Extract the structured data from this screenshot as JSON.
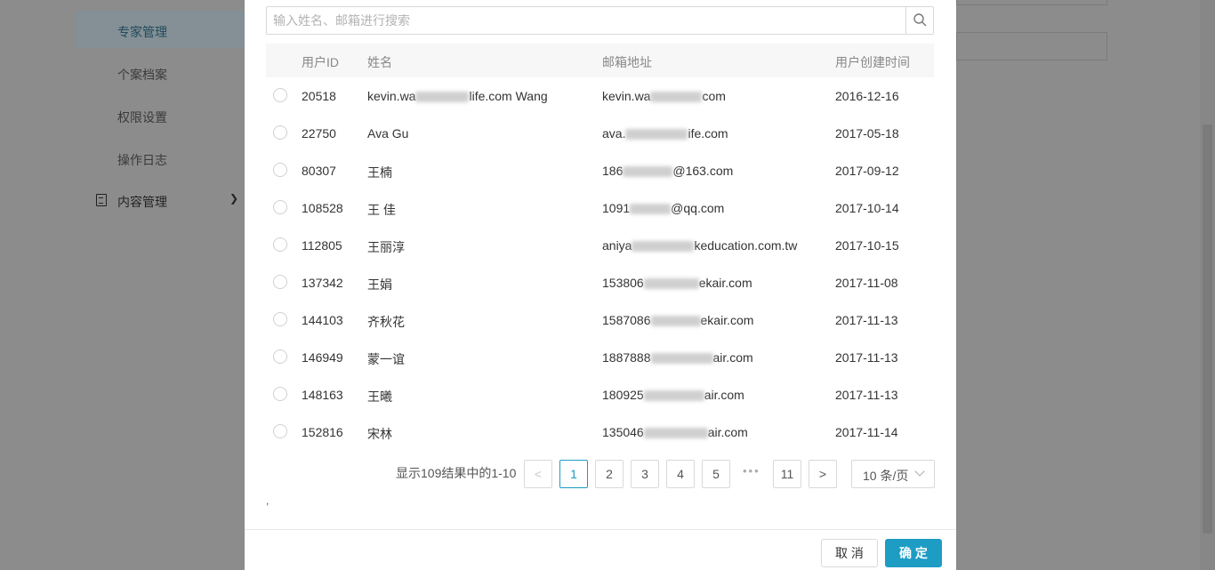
{
  "sidebar": {
    "items": [
      {
        "label": "专家管理",
        "active": true
      },
      {
        "label": "个案档案"
      },
      {
        "label": "权限设置"
      },
      {
        "label": "操作日志"
      }
    ],
    "group": {
      "label": "内容管理",
      "icon": "document-icon",
      "chevron": "chevron-down-icon"
    }
  },
  "modal": {
    "search": {
      "placeholder": "输入姓名、邮箱进行搜索",
      "value": "",
      "icon": "search-icon"
    },
    "columns": {
      "id": "用户ID",
      "name": "姓名",
      "email": "邮箱地址",
      "created": "用户创建时间"
    },
    "rows": [
      {
        "id": "20518",
        "name_pre": "kevin.wa",
        "name_post": "life.com Wang",
        "email_pre": "kevin.wa",
        "email_post": "com",
        "created": "2016-12-16"
      },
      {
        "id": "22750",
        "name_pre": "Ava Gu",
        "name_post": "",
        "email_pre": "ava.",
        "email_post": "ife.com",
        "created": "2017-05-18"
      },
      {
        "id": "80307",
        "name_pre": "王楠",
        "name_post": "",
        "email_pre": "186",
        "email_post": "@163.com",
        "created": "2017-09-12"
      },
      {
        "id": "108528",
        "name_pre": "王 佳",
        "name_post": "",
        "email_pre": "1091",
        "email_post": "@qq.com",
        "created": "2017-10-14"
      },
      {
        "id": "112805",
        "name_pre": "王丽淳",
        "name_post": "",
        "email_pre": "aniya",
        "email_post": "keducation.com.tw",
        "created": "2017-10-15"
      },
      {
        "id": "137342",
        "name_pre": "王娟",
        "name_post": "",
        "email_pre": "153806",
        "email_post": "ekair.com",
        "created": "2017-11-08"
      },
      {
        "id": "144103",
        "name_pre": "齐秋花",
        "name_post": "",
        "email_pre": "1587086",
        "email_post": "ekair.com",
        "created": "2017-11-13"
      },
      {
        "id": "146949",
        "name_pre": "蒙一谊",
        "name_post": "",
        "email_pre": "1887888",
        "email_post": "air.com",
        "created": "2017-11-13"
      },
      {
        "id": "148163",
        "name_pre": "王曦",
        "name_post": "",
        "email_pre": "180925",
        "email_post": "air.com",
        "created": "2017-11-13"
      },
      {
        "id": "152816",
        "name_pre": "宋林",
        "name_post": "",
        "email_pre": "135046",
        "email_post": "air.com",
        "created": "2017-11-14"
      }
    ],
    "pagination": {
      "info": "显示109结果中的1-10",
      "prev": "<",
      "next": ">",
      "pages": [
        "1",
        "2",
        "3",
        "4",
        "5"
      ],
      "ellipsis": "•••",
      "last": "11",
      "current": "1",
      "page_size": "10 条/页"
    },
    "stray_text": ",",
    "footer": {
      "cancel": "取 消",
      "ok": "确 定"
    }
  },
  "colors": {
    "primary": "#1d9cc4",
    "overlay": "#8c8c8c"
  }
}
